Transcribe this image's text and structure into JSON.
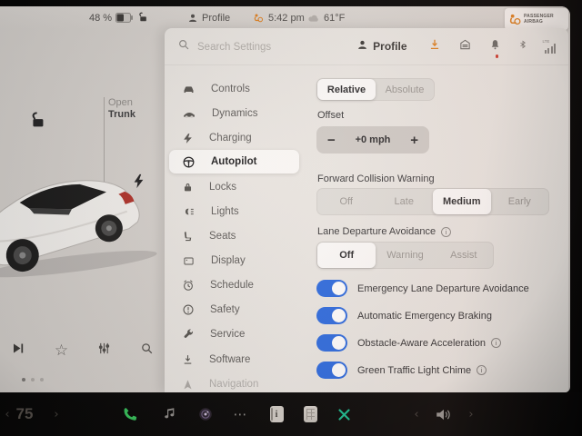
{
  "colors": {
    "accent_blue": "#2b6ae0",
    "accent_orange": "#df7f1e",
    "phone_green": "#35c05a",
    "x_teal": "#17b98e",
    "alert_red": "#cf3b2f"
  },
  "status_bar": {
    "battery_percent": "48 %",
    "profile_label": "Profile",
    "time": "5:42 pm",
    "outside_temp": "61°F",
    "airbag_line1": "PASSENGER",
    "airbag_line2": "AIRBAG"
  },
  "car_panel": {
    "open_label": "Open",
    "trunk_label": "Trunk"
  },
  "settings": {
    "search_placeholder": "Search Settings",
    "profile_label": "Profile",
    "signal_type": "LTE",
    "sidebar": [
      {
        "label": "Controls"
      },
      {
        "label": "Dynamics"
      },
      {
        "label": "Charging"
      },
      {
        "label": "Autopilot"
      },
      {
        "label": "Locks"
      },
      {
        "label": "Lights"
      },
      {
        "label": "Seats"
      },
      {
        "label": "Display"
      },
      {
        "label": "Schedule"
      },
      {
        "label": "Safety"
      },
      {
        "label": "Service"
      },
      {
        "label": "Software"
      },
      {
        "label": "Navigation"
      }
    ],
    "active_item": "Autopilot",
    "autopilot": {
      "mode_options": [
        "Relative",
        "Absolute"
      ],
      "mode_selected": "Relative",
      "offset_label": "Offset",
      "offset_value": "+0 mph",
      "minus_glyph": "−",
      "plus_glyph": "+",
      "fcw_label": "Forward Collision Warning",
      "fcw_options": [
        "Off",
        "Late",
        "Medium",
        "Early"
      ],
      "fcw_selected": "Medium",
      "lda_label": "Lane Departure Avoidance",
      "lda_options": [
        "Off",
        "Warning",
        "Assist"
      ],
      "lda_selected": "Off",
      "toggles": [
        {
          "label": "Emergency Lane Departure Avoidance",
          "state": "on"
        },
        {
          "label": "Automatic Emergency Braking",
          "state": "on"
        },
        {
          "label": "Obstacle-Aware Acceleration",
          "state": "on",
          "info": true
        },
        {
          "label": "Green Traffic Light Chime",
          "state": "on",
          "info": true
        }
      ]
    }
  },
  "bottom_bar": {
    "cabin_temp": "75",
    "chevron_left": "‹",
    "chevron_right": "›",
    "more_glyph": "⋯"
  },
  "icons": {
    "star": "☆",
    "info": "i",
    "app_note": "i"
  }
}
